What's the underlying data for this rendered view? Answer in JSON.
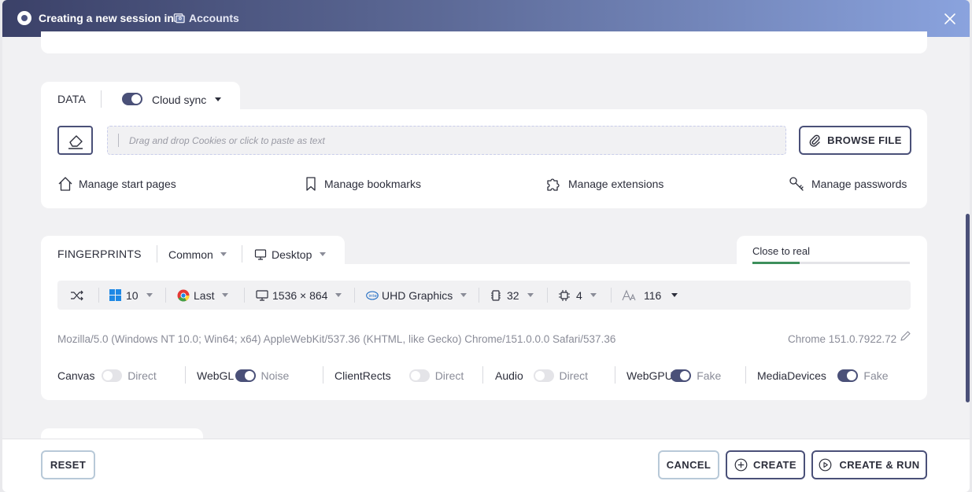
{
  "titlebar": {
    "title": "Creating a new session in",
    "folder": "Accounts"
  },
  "data_section": {
    "tab_label": "DATA",
    "cloud_sync_label": "Cloud sync",
    "cloud_sync_on": true,
    "drop_placeholder": "Drag and drop Cookies or click to paste as text",
    "browse_label": "BROWSE FILE",
    "links": [
      {
        "label": "Manage start pages",
        "icon": "home-icon"
      },
      {
        "label": "Manage bookmarks",
        "icon": "bookmark-icon"
      },
      {
        "label": "Manage extensions",
        "icon": "puzzle-icon"
      },
      {
        "label": "Manage passwords",
        "icon": "key-icon"
      }
    ]
  },
  "fingerprints": {
    "tab_label": "FINGERPRINTS",
    "mode": "Common",
    "device": "Desktop",
    "quality_label": "Close to real",
    "quality_level": 0.3,
    "bar": {
      "os": "10",
      "browser": "Last",
      "resolution": "1536 × 864",
      "gpu": "UHD Graphics",
      "memory": "32",
      "cpu": "4",
      "fonts": "116"
    },
    "user_agent": "Mozilla/5.0 (Windows NT 10.0; Win64; x64) AppleWebKit/537.36 (KHTML, like Gecko) Chrome/151.0.0.0 Safari/537.36",
    "browser_version": "Chrome 151.0.7922.72",
    "toggles": [
      {
        "name": "Canvas",
        "value": "Direct",
        "on": false
      },
      {
        "name": "WebGL",
        "value": "Noise",
        "on": true
      },
      {
        "name": "ClientRects",
        "value": "Direct",
        "on": false
      },
      {
        "name": "Audio",
        "value": "Direct",
        "on": false
      },
      {
        "name": "WebGPU",
        "value": "Fake",
        "on": true
      },
      {
        "name": "MediaDevices",
        "value": "Fake",
        "on": true
      }
    ]
  },
  "footer": {
    "reset": "RESET",
    "cancel": "CANCEL",
    "create": "CREATE",
    "create_run": "CREATE & RUN"
  },
  "colors": {
    "accent": "#4a5078",
    "quality": "#3d8f5c"
  }
}
